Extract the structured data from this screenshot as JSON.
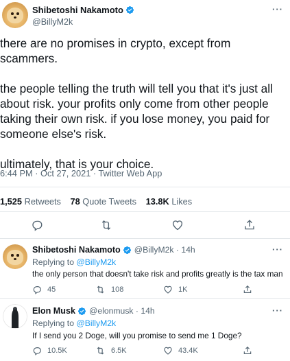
{
  "tweet": {
    "author_name": "Shibetoshi Nakamoto",
    "handle": "@BillyM2k",
    "paragraphs": [
      [
        "there are no promises in crypto, except from",
        "scammers."
      ],
      [
        "the people telling the truth will tell you that it's just all",
        "about risk. your profits only come from other people",
        "taking their own risk. if you lose money, you paid for",
        "someone else's risk."
      ],
      [
        "ultimately, that is your choice."
      ]
    ],
    "meta": "6:44 PM · Oct 27, 2021 · Twitter Web App",
    "stats": {
      "retweets_count": "1,525",
      "retweets_label": "Retweets",
      "quotes_count": "78",
      "quotes_label": "Quote Tweets",
      "likes_count": "13.8K",
      "likes_label": "Likes"
    },
    "more_glyph": "···"
  },
  "replies": [
    {
      "author_name": "Shibetoshi Nakamoto",
      "handle_time": "@BillyM2k · 14h",
      "replying_prefix": "Replying to ",
      "replying_to": "@BillyM2k",
      "text": "the only person that doesn't take risk and profits greatly is the tax man",
      "reply_count": "45",
      "retweet_count": "108",
      "like_count": "1K",
      "more_glyph": "···",
      "avatar": "doge-avatar"
    },
    {
      "author_name": "Elon Musk",
      "handle_time": "@elonmusk · 14h",
      "replying_prefix": "Replying to ",
      "replying_to": "@BillyM2k",
      "text": "If I send you 2 Doge, will you promise to send me 1 Doge?",
      "reply_count": "10.5K",
      "retweet_count": "6.5K",
      "like_count": "43.4K",
      "more_glyph": "···",
      "avatar": "elon-avatar"
    }
  ],
  "colors": {
    "verified": "#1d9bf0",
    "link": "#1d9bf0",
    "secondary_text": "#536471",
    "primary_text": "#0f1419"
  },
  "icons": [
    "verified-badge-icon",
    "reply-icon",
    "retweet-icon",
    "like-icon",
    "share-icon",
    "more-icon"
  ]
}
